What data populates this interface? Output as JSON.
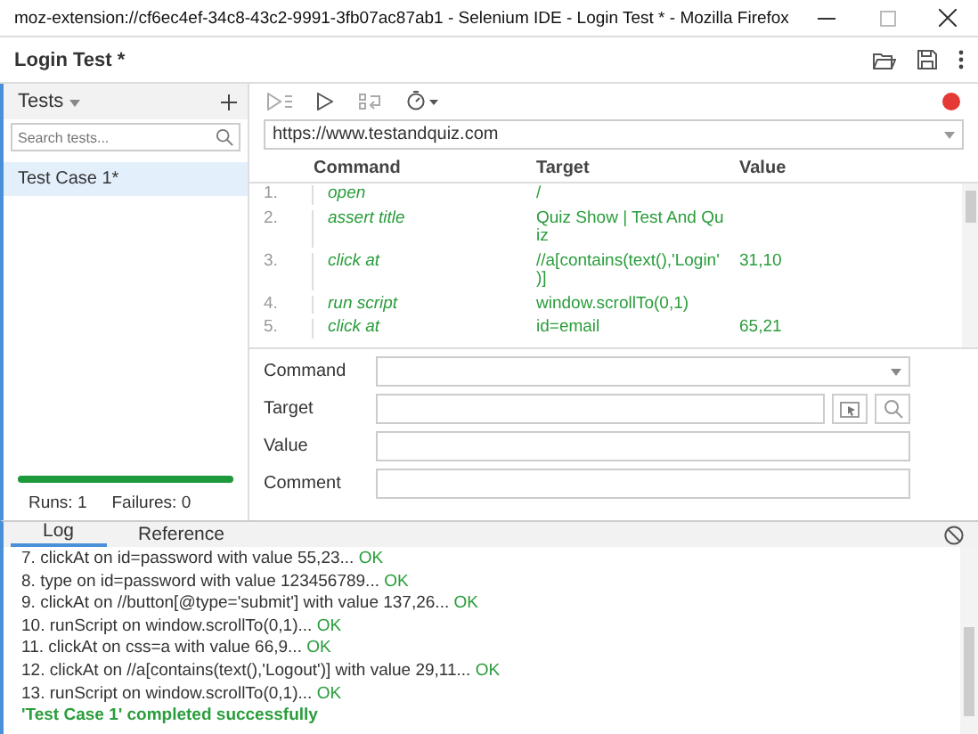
{
  "window": {
    "title": "moz-extension://cf6ec4ef-34c8-43c2-9991-3fb07ac87ab1 - Selenium IDE - Login Test * - Mozilla Firefox"
  },
  "project": {
    "title": "Login Test *"
  },
  "sidebar": {
    "header": "Tests",
    "search": {
      "placeholder": "Search tests..."
    },
    "tests": [
      {
        "name": "Test Case 1*",
        "selected": true
      }
    ],
    "progress": {
      "level": 1
    },
    "runs": "Runs: 1",
    "failures": "Failures: 0"
  },
  "url": "https://www.testandquiz.com",
  "table": {
    "columns": [
      "Command",
      "Target",
      "Value"
    ],
    "rows": [
      {
        "num": "1.",
        "command": "open",
        "target": "/",
        "value": ""
      },
      {
        "num": "2.",
        "command": "assert title",
        "target": "Quiz Show | Test And Qu iz",
        "value": ""
      },
      {
        "num": "3.",
        "command": "click at",
        "target": "//a[contains(text(),'Login' )]",
        "value": "31,10"
      },
      {
        "num": "4.",
        "command": "run script",
        "target": "window.scrollTo(0,1)",
        "value": ""
      },
      {
        "num": "5.",
        "command": "click at",
        "target": "id=email",
        "value": "65,21"
      }
    ]
  },
  "form": {
    "fields": [
      {
        "label": "Command",
        "kind": "select"
      },
      {
        "label": "Target",
        "kind": "target"
      },
      {
        "label": "Value",
        "kind": "text"
      },
      {
        "label": "Comment",
        "kind": "text"
      }
    ]
  },
  "log": {
    "tabs": [
      {
        "label": "Log",
        "selected": true
      },
      {
        "label": "Reference",
        "selected": false
      }
    ],
    "lines": [
      {
        "num": "7.",
        "text": "clickAt on id=password with value 55,23...",
        "status": "OK"
      },
      {
        "num": "8.",
        "text": "type on id=password with value 123456789...",
        "status": "OK"
      },
      {
        "num": "9.",
        "text": "clickAt on //button[@type='submit'] with value 137,26...",
        "status": "OK"
      },
      {
        "num": "10.",
        "text": "runScript on window.scrollTo(0,1)...",
        "status": "OK"
      },
      {
        "num": "11.",
        "text": "clickAt on css=a with value 66,9...",
        "status": "OK"
      },
      {
        "num": "12.",
        "text": "clickAt on //a[contains(text(),'Logout')] with value 29,11...",
        "status": "OK"
      },
      {
        "num": "13.",
        "text": "runScript on window.scrollTo(0,1)...",
        "status": "OK"
      }
    ],
    "result": "'Test Case 1' completed successfully"
  }
}
